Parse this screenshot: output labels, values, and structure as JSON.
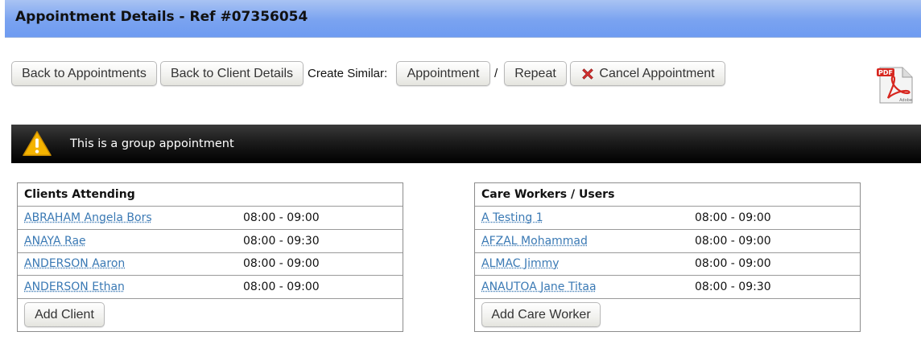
{
  "header": {
    "title": "Appointment Details - Ref #07356054"
  },
  "toolbar": {
    "back_appointments": "Back to Appointments",
    "back_client": "Back to Client Details",
    "create_similar_label": "Create Similar:",
    "appointment": "Appointment",
    "separator": "/",
    "repeat": "Repeat",
    "cancel": "Cancel Appointment",
    "pdf_icon_text": "PDF",
    "pdf_icon_sub": "Adobe"
  },
  "alert": {
    "message": "This is a group appointment",
    "icon": "warning-icon"
  },
  "clients": {
    "heading": "Clients Attending",
    "rows": [
      {
        "name": "ABRAHAM Angela Bors",
        "time": "08:00 - 09:00"
      },
      {
        "name": "ANAYA Rae",
        "time": "08:00 - 09:30"
      },
      {
        "name": "ANDERSON Aaron",
        "time": "08:00 - 09:00"
      },
      {
        "name": "ANDERSON Ethan",
        "time": "08:00 - 09:00"
      }
    ],
    "add_button": "Add Client"
  },
  "workers": {
    "heading": "Care Workers / Users",
    "rows": [
      {
        "name": "A Testing 1",
        "time": "08:00 - 09:00"
      },
      {
        "name": "AFZAL Mohammad",
        "time": "08:00 - 09:00"
      },
      {
        "name": "ALMAC Jimmy",
        "time": "08:00 - 09:00"
      },
      {
        "name": "ANAUTOA Jane Titaa",
        "time": "08:00 - 09:30"
      }
    ],
    "add_button": "Add Care Worker"
  },
  "colors": {
    "link": "#3a79b4",
    "title_bar": "#7aa3f0",
    "alert_bar": "#000000",
    "cancel_icon": "#d9302f"
  }
}
